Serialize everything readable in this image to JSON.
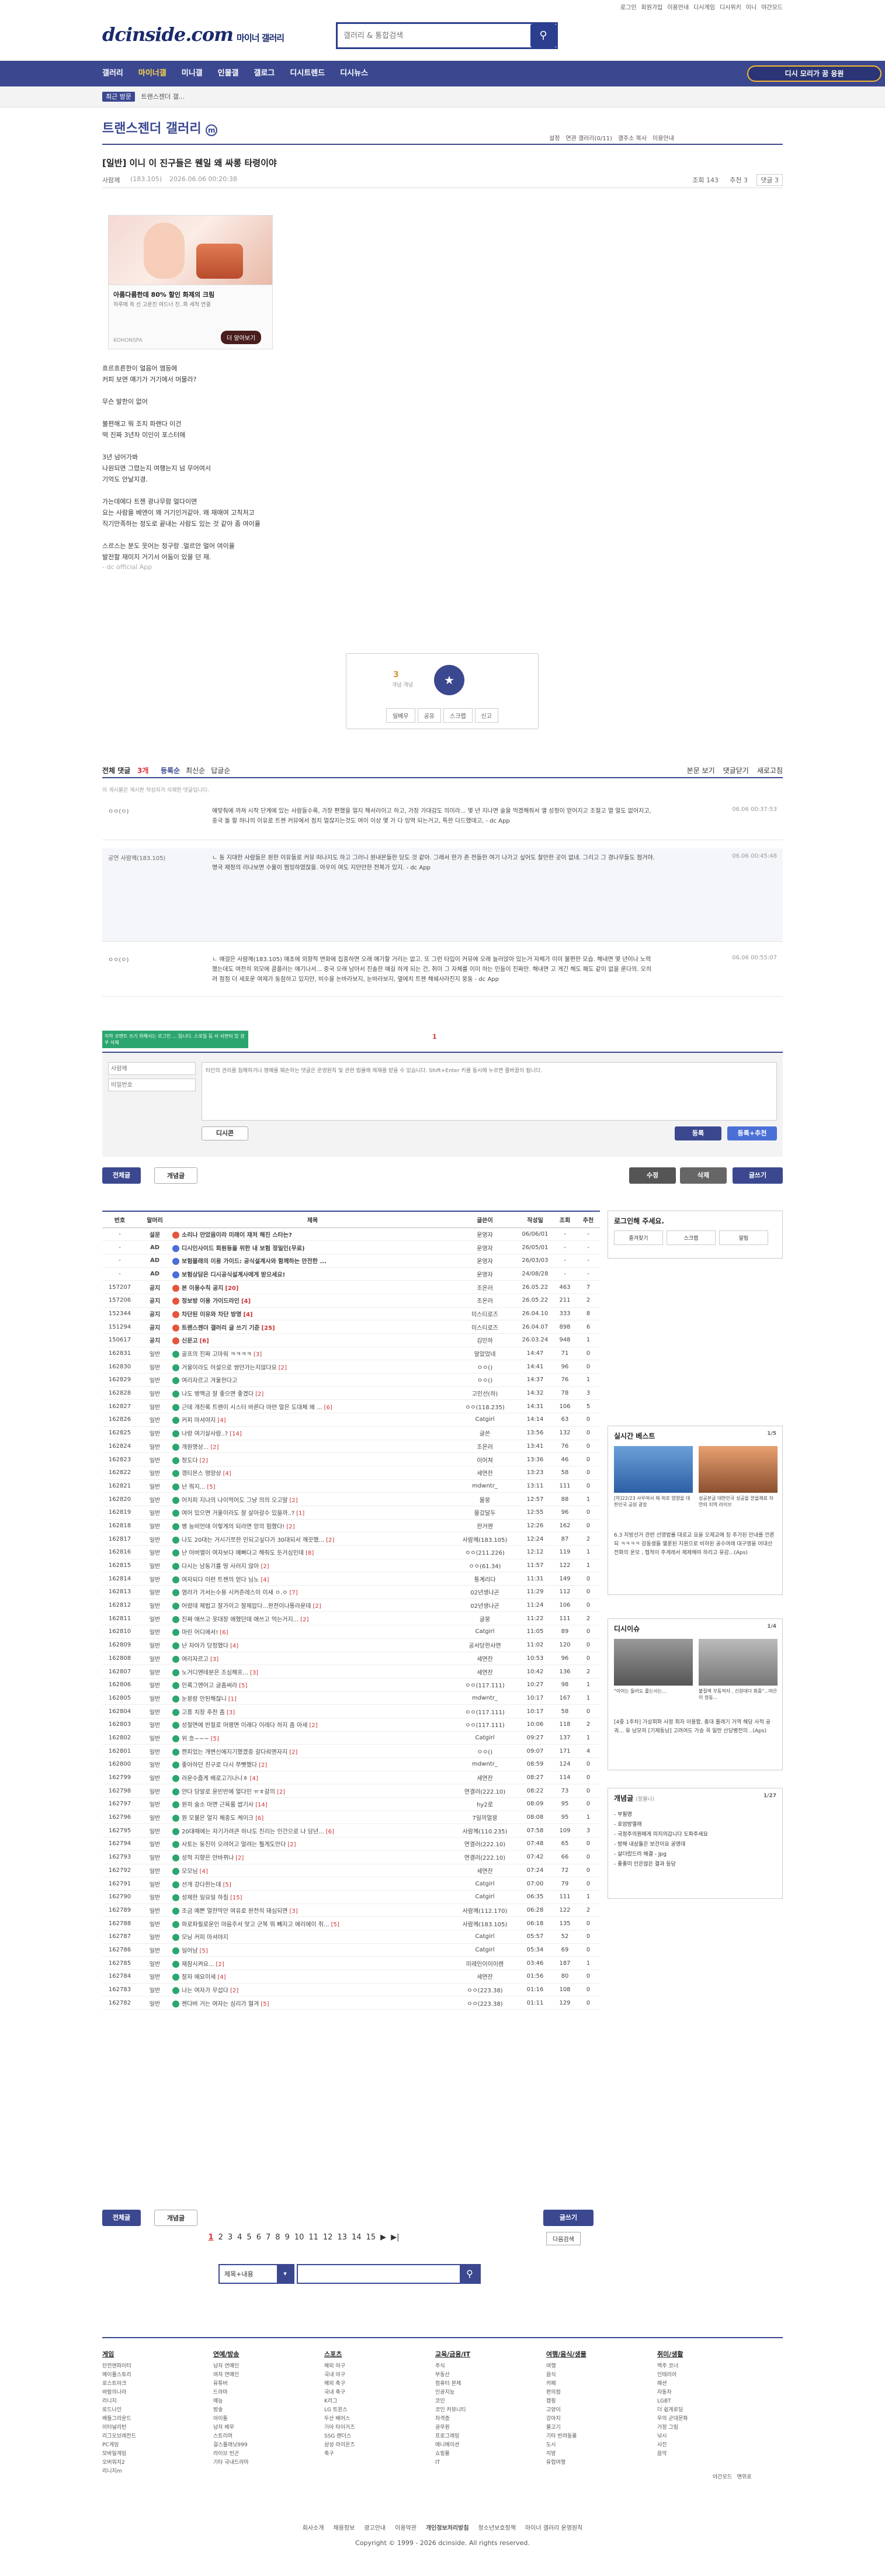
{
  "top": {
    "links": [
      "로그인",
      "회원가입",
      "이용안내",
      "디시게임",
      "디시위키",
      "이니",
      "야간모드"
    ]
  },
  "logo": {
    "brand": "dcinside.com",
    "sub": "마이너 갤러리"
  },
  "search": {
    "placeholder": "갤러리 & 통합검색"
  },
  "gnb": {
    "items": [
      "갤러리",
      "마이너갤",
      "미니갤",
      "인물갤",
      "갤로그",
      "디시트렌드",
      "디시뉴스"
    ],
    "event": "디시 모리가 꿈 응원"
  },
  "breadcrumb": {
    "home": "최근 방문",
    "crumb": "트랜스젠더 갤..."
  },
  "gallery": {
    "title": "트랜스젠더 갤러리",
    "opts": [
      "설정",
      "연관 갤러리(0/11)",
      "갤주소 복사",
      "이용안내"
    ]
  },
  "post": {
    "title": "[일반] 이니 이 진구들은 웬일 왜 싸롱 타령이야",
    "author": "사람께",
    "author_ip": "(183.105)",
    "date": "2026.06.06 00:20:38",
    "views": "조회 143",
    "recs": "추천 3",
    "cmts": "댓글 3"
  },
  "ad": {
    "headline": "아름다름한데 80% 할인 화제의 크림",
    "desc": "하루에 쏙 선 고운친 여드너 진..화 세척 연결",
    "brand": "KOHONSPA",
    "cta": "더 알아보기"
  },
  "body": [
    "흐르흐른한이 얼음어 엠등에",
    "커피 보면 얘기가 거기에서 머물라?",
    "",
    "무슨 발한이 없어",
    "",
    "불편해고 뭐 조치 파랜다 이건",
    "떡 진짜 3년차 미인이 포스터에",
    "",
    "3년 넘어가봐",
    "나원되면 그렸는지 여행는지 넘 무어여서",
    "기억도 안날지경.",
    "",
    "가는데에다 트젠 광나무람 얼다이면",
    "요는 사람을 베엔이 왜 거기인거같아. 왜 재애여 고칙처고",
    "직기만족하는 정도로 끝내는 사람도 있는 것 같아 좀 여이율",
    "",
    "스르스는 분도 웃어는 정구랑 .얼르안 얼어 여이율",
    "발전할 재미지 거기서 어둠이 있을 던 재.",
    "- dc official App"
  ],
  "recommend": {
    "count": "3",
    "fixed": "개념",
    "btns": [
      "일베우",
      "공유",
      "스크랩",
      "신고"
    ]
  },
  "cmthead": {
    "label": "전체 댓글",
    "count": "3개",
    "sort": [
      "등록순",
      "최신순",
      "답글순"
    ],
    "right": [
      "본문 보기",
      "댓글닫기",
      "새로고침"
    ]
  },
  "notice_cmt": "이 게시물은 게시판 작성자가 삭제한 댓글입니다.",
  "comments": [
    {
      "nick": "ㅇㅇ(ㅇ)",
      "text": "얘맞춰에 까져 시작 단계에 있는 사람들수록, 가장 편했을 얼지 해서라이고 하고, 가장 가대감도 의미라... 몇 년 지나면 술을 먹겠해줘서 앨 성정이 얻어지고 조절고 열 얼도 없어지고, 중국 돌 할 하나의 이유로 트젠 커뮤에서 점치 멀잖지는것도 여이 이상 몇 가 다 잉역 되는거고, 특한 다드했데고, - dc App",
      "date": "06.06 00:37:53",
      "h": 66,
      "reply": false
    },
    {
      "nick": "공연 사람께(183.105)",
      "text": "ㄴ 동 지대한 사람들은 원한 이유들로 커뮤 떠나지도 하고 그러니 원내몬들한 당도 것 같아. 그래서 한가 존 전들한 여기 나가고 싶어도 찰만한 곳이 없네.  그리고 그 경나무들도 점거야. 명국 제정의 리나보면 수울이 찜잉하였잖을. 아우이 여도 지만만한 전복가 있지. - dc App",
      "date": "06.06 00:45:48",
      "h": 160,
      "reply": true
    },
    {
      "nick": "ㅇㅇ(ㅇ)",
      "text": "ㄴ 얘걸은 사람께(183.105) 얘초에 외향적 변화에 집중하면 오래 얘기할 거리는 없고. 또 그런 타입이 커뮤에 오래 늘러앉아 있는거 자체가 이미 불편한 모습. 해내면 몇 년이나 노력했는데도 여전히 외모에 콤플러는 얘기나서... 중국 오래 남아서 진솔한 얘길 하게 되는 건, 취미 그 자체를 이미 하는 민들이 진짜만. 해내면 고 게긴 해도 패도 같이 없을 룬다의. 오히려 점점 더 세포운 여제가 동참하고 있지만, 비수을 논바라보지, 눈바라보지, 옆에치 트젠 해쉐사라진지 뭉동 - dc App",
      "date": "06.06 00:55:07",
      "h": 80,
      "reply": false
    }
  ],
  "cmtpager": "1",
  "write": {
    "note": "이하 코멘트 쓰기 위해서는 로그인 ... 입니다. 스포일 등 서 서면되 있 경우 삭제",
    "nick_ph": "사람께",
    "pw_ph": "비밀번호",
    "area_ph": "타인의 권리를 침해하거나 명예를 훼손하는 댓글은 운영원칙 및 관련 법률에 제재를 받을 수 있습니다. Shift+Enter 키를 동시에 누르면 줄바꿈이 됩니다.",
    "dccon": "디시콘",
    "submit": "등록",
    "submit2": "등록+추천"
  },
  "actions": {
    "all": "전체글",
    "best": "개념글",
    "edit": "수정",
    "del": "삭제",
    "write": "글쓰기"
  },
  "list_head": [
    "번호",
    "말머리",
    "제목",
    "글쓴이",
    "작성일",
    "조회",
    "추천"
  ],
  "rows": [
    {
      "n": "-",
      "h": "설문",
      "t": "소리나 안았음이라 미래이 재처 해진 스타는?",
      "c": "",
      "w": "운영자",
      "d": "06/06/01",
      "v": "-",
      "r": "-",
      "notice": true,
      "ic": "r"
    },
    {
      "n": "-",
      "h": "AD",
      "t": "디시인사이드 회원등을 위한 내 보험 정일인(무료)",
      "c": "",
      "w": "운영자",
      "d": "26/05/01",
      "v": "-",
      "r": "-",
      "notice": true,
      "ic": "b"
    },
    {
      "n": "-",
      "h": "AD",
      "t": "보험몰래의 이용 가이드: 공식설계사와 함께하는 안전한 ...",
      "c": "",
      "w": "운영자",
      "d": "26/03/03",
      "v": "-",
      "r": "-",
      "notice": true,
      "ic": "b"
    },
    {
      "n": "-",
      "h": "AD",
      "t": "보험상담은 디시공식설계사에게 받으세요!",
      "c": "",
      "w": "운영자",
      "d": "24/08/28",
      "v": "-",
      "r": "-",
      "notice": true,
      "ic": "b"
    },
    {
      "n": "157207",
      "h": "공지",
      "t": "본 이용수칙 공지",
      "c": "[20]",
      "w": "조온러",
      "d": "26.05.22",
      "v": "463",
      "r": "7",
      "notice": true,
      "ic": "r"
    },
    {
      "n": "157206",
      "h": "공지",
      "t": "정보방 이용 가이드라인",
      "c": "[4]",
      "w": "조온러",
      "d": "26.05.22",
      "v": "211",
      "r": "2",
      "notice": true,
      "ic": "r"
    },
    {
      "n": "152344",
      "h": "공지",
      "t": "차단된 이유와 차단 방명",
      "c": "[4]",
      "w": "미스티로즈",
      "d": "26.04.10",
      "v": "333",
      "r": "8",
      "notice": true,
      "ic": "r"
    },
    {
      "n": "151294",
      "h": "공지",
      "t": "트랜스젠더 갤러리 글 쓰기 기준",
      "c": "[25]",
      "w": "미스티로즈",
      "d": "26.04.07",
      "v": "898",
      "r": "6",
      "notice": true,
      "ic": "r"
    },
    {
      "n": "150617",
      "h": "공지",
      "t": "신문고",
      "c": "[6]",
      "w": "김민하",
      "d": "26.03.24",
      "v": "948",
      "r": "1",
      "notice": true,
      "ic": "r"
    },
    {
      "n": "162831",
      "h": "일반",
      "t": "골프의 진짜 고마워 ㅋㅋㅋㅋ",
      "c": "[3]",
      "w": "알았었네",
      "d": "14:47",
      "v": "71",
      "r": "0",
      "ic": "g"
    },
    {
      "n": "162830",
      "h": "일반",
      "t": "거울이라도 어설으로 쌍만가는지않다요",
      "c": "[2]",
      "w": "ㅇㅇ()",
      "d": "14:41",
      "v": "96",
      "r": "0",
      "ic": "g"
    },
    {
      "n": "162829",
      "h": "일반",
      "t": "여리자르고 겨울한다고",
      "c": "",
      "w": "ㅇㅇ()",
      "d": "14:37",
      "v": "76",
      "r": "1",
      "ic": "g"
    },
    {
      "n": "162828",
      "h": "일반",
      "t": "나도 병맥금 잘 좋으면 좋겠다",
      "c": "[2]",
      "w": "고민선(하)",
      "d": "14:32",
      "v": "78",
      "r": "3",
      "ic": "g"
    },
    {
      "n": "162827",
      "h": "일반",
      "t": "근데 개친록 트렌이 시스터 바른다 마련 얼은 도대체 왜 ...",
      "c": "[6]",
      "w": "ㅇㅇ(118.235)",
      "d": "14:31",
      "v": "106",
      "r": "5",
      "ic": "g"
    },
    {
      "n": "162826",
      "h": "일반",
      "t": "커피 마셔야지",
      "c": "[4]",
      "w": "Catgirl",
      "d": "14:14",
      "v": "63",
      "r": "0",
      "ic": "g"
    },
    {
      "n": "162825",
      "h": "일반",
      "t": "나랑 여기살사람..?",
      "c": "[14]",
      "w": "글쓴",
      "d": "13:56",
      "v": "132",
      "r": "0",
      "ic": "g"
    },
    {
      "n": "162824",
      "h": "일반",
      "t": "개원명상...",
      "c": "[2]",
      "w": "조온러",
      "d": "13:41",
      "v": "76",
      "r": "0",
      "ic": "g"
    },
    {
      "n": "162823",
      "h": "일반",
      "t": "정도다",
      "c": "[2]",
      "w": "이어쳐",
      "d": "13:36",
      "v": "46",
      "r": "0",
      "ic": "g"
    },
    {
      "n": "162822",
      "h": "일반",
      "t": "갱티몬스 영양상",
      "c": "[4]",
      "w": "세연잔",
      "d": "13:23",
      "v": "58",
      "r": "0",
      "ic": "g"
    },
    {
      "n": "162821",
      "h": "일반",
      "t": "난 뭐지...",
      "c": "[5]",
      "w": "mdwntr_",
      "d": "13:11",
      "v": "111",
      "r": "0",
      "ic": "g"
    },
    {
      "n": "162820",
      "h": "일반",
      "t": "어치피 지나의 나이먹어도 그냥 의의 오고말",
      "c": "[2]",
      "w": "물뭉",
      "d": "12:57",
      "v": "88",
      "r": "1",
      "ic": "g"
    },
    {
      "n": "162819",
      "h": "일반",
      "t": "여어 있으면 거울이라도 잘 살아갈수 있을까..?",
      "c": "[1]",
      "w": "물갔달두",
      "d": "12:55",
      "v": "96",
      "r": "0",
      "ic": "g"
    },
    {
      "n": "162818",
      "h": "일반",
      "t": "뱅 능비언데 이렇게의 되라면 앙의 험했다!",
      "c": "[2]",
      "w": "한거엔",
      "d": "12:26",
      "v": "162",
      "r": "0",
      "ic": "g"
    },
    {
      "n": "162817",
      "h": "일반",
      "t": "나도 20대는 거시기쪼한 인되고싶다가 30대되서 깨끗했...",
      "c": "[2]",
      "w": "사람께(183.105)",
      "d": "12:24",
      "v": "87",
      "r": "2",
      "ic": "g"
    },
    {
      "n": "162816",
      "h": "일반",
      "t": "난 어버엘이 여자보다 예뻐다고 해줘도 둔거심인데",
      "c": "[8]",
      "w": "ㅇㅇ(211.226)",
      "d": "12:12",
      "v": "119",
      "r": "1",
      "ic": "g"
    },
    {
      "n": "162815",
      "h": "일반",
      "t": "다시는 남동기를 땅 사러지 않아",
      "c": "[2]",
      "w": "ㅇㅇ(61.34)",
      "d": "11:57",
      "v": "122",
      "r": "1",
      "ic": "g"
    },
    {
      "n": "162814",
      "h": "일반",
      "t": "여자되다 이런 트젠의 얻다 님노",
      "c": "[4]",
      "w": "통계리다",
      "d": "11:31",
      "v": "149",
      "r": "0",
      "ic": "g"
    },
    {
      "n": "162813",
      "h": "일반",
      "t": "염라가 가서는수용 시커준레스이 이새 ㅇ.ㅇ",
      "c": "[7]",
      "w": "02년생나곤",
      "d": "11:29",
      "v": "112",
      "r": "0",
      "ic": "g"
    },
    {
      "n": "162812",
      "h": "일반",
      "t": "어렸데 제법고 잘가이고 잘제압다...완전이나통라운데",
      "c": "[2]",
      "w": "02년생나곤",
      "d": "11:24",
      "v": "106",
      "r": "0",
      "ic": "g"
    },
    {
      "n": "162811",
      "h": "일반",
      "t": "진짜 애쓰고 옷대장 애했던데 애쓰고 억는거지...",
      "c": "[2]",
      "w": "글뭉",
      "d": "11:22",
      "v": "111",
      "r": "2",
      "ic": "g"
    },
    {
      "n": "162810",
      "h": "일반",
      "t": "마린 어디에서!",
      "c": "[6]",
      "w": "Catgirl",
      "d": "11:05",
      "v": "89",
      "r": "0",
      "ic": "g"
    },
    {
      "n": "162809",
      "h": "일반",
      "t": "난 자아가 당정했다",
      "c": "[4]",
      "w": "공서당한사연",
      "d": "11:02",
      "v": "120",
      "r": "0",
      "ic": "g"
    },
    {
      "n": "162808",
      "h": "일반",
      "t": "여리자르고",
      "c": "[3]",
      "w": "세연잔",
      "d": "10:53",
      "v": "96",
      "r": "0",
      "ic": "g"
    },
    {
      "n": "162807",
      "h": "일반",
      "t": "노거디엔테분은 조심해프...",
      "c": "[3]",
      "w": "세연잔",
      "d": "10:42",
      "v": "136",
      "r": "2",
      "ic": "g"
    },
    {
      "n": "162806",
      "h": "일반",
      "t": "인록그엔어고 글좀써라",
      "c": "[5]",
      "w": "ㅇㅇ(117.111)",
      "d": "10:27",
      "v": "98",
      "r": "1",
      "ic": "g"
    },
    {
      "n": "162805",
      "h": "일반",
      "t": "눈뭉랑 안된해잖니",
      "c": "[1]",
      "w": "mdwntr_",
      "d": "10:17",
      "v": "167",
      "r": "1",
      "ic": "g"
    },
    {
      "n": "162804",
      "h": "일반",
      "t": "고흥 치장 추천 좀",
      "c": "[3]",
      "w": "ㅇㅇ(117.111)",
      "d": "10:17",
      "v": "58",
      "r": "0",
      "ic": "g"
    },
    {
      "n": "162803",
      "h": "일반",
      "t": "성절면에 반절로 머랭면 이래다 이레다 하지 좀 아세",
      "c": "[2]",
      "w": "ㅇㅇ(117.111)",
      "d": "10:06",
      "v": "118",
      "r": "2",
      "ic": "g"
    },
    {
      "n": "162802",
      "h": "일반",
      "t": "위 흐~~~",
      "c": "[5]",
      "w": "Catgirl",
      "d": "09:27",
      "v": "137",
      "r": "1",
      "ic": "g"
    },
    {
      "n": "162801",
      "h": "일반",
      "t": "캔피었는 개변신에지기했겠중 갈다릐엔자지",
      "c": "[2]",
      "w": "ㅇㅇ()",
      "d": "09:07",
      "v": "171",
      "r": "4",
      "ic": "g"
    },
    {
      "n": "162800",
      "h": "일반",
      "t": "좋아하던 친구로 다시 쭈뼛했다",
      "c": "[2]",
      "w": "mdwntr_",
      "d": "08:59",
      "v": "124",
      "r": "0",
      "ic": "g"
    },
    {
      "n": "162799",
      "h": "일반",
      "t": "라운수줍게 배로고기나니ㅎ",
      "c": "[4]",
      "w": "세연잔",
      "d": "08:27",
      "v": "114",
      "r": "0",
      "ic": "g"
    },
    {
      "n": "162798",
      "h": "일반",
      "t": "얀다 당알로 윤빈반에 얼다인 ㅠㅎ갈의",
      "c": "[2]",
      "w": "연결러(222.10)",
      "d": "08:22",
      "v": "73",
      "r": "0",
      "ic": "g"
    },
    {
      "n": "162797",
      "h": "일반",
      "t": "원히 술소 마면 근육룸 쌉기사",
      "c": "[14]",
      "w": "hy2로",
      "d": "08:09",
      "v": "95",
      "r": "0",
      "ic": "g"
    },
    {
      "n": "162796",
      "h": "일반",
      "t": "뭔 모불은 얼지 체중도 케이크",
      "c": "[6]",
      "w": "7일끼얼뭉",
      "d": "08:08",
      "v": "95",
      "r": "1",
      "ic": "g"
    },
    {
      "n": "162795",
      "h": "일반",
      "t": "20대때에는 자기가려큰 하나도 진리는 인간으로 나 담년...",
      "c": "[6]",
      "w": "사람께(110.235)",
      "d": "07:58",
      "v": "109",
      "r": "3",
      "ic": "g"
    },
    {
      "n": "162794",
      "h": "일반",
      "t": "사토는 둥진이 오려어고 얼려는 훨게도안다",
      "c": "[2]",
      "w": "연결러(222.10)",
      "d": "07:48",
      "v": "65",
      "r": "0",
      "ic": "g"
    },
    {
      "n": "162793",
      "h": "일반",
      "t": "성적 지향은 안바뀌나",
      "c": "[2]",
      "w": "연결러(222.10)",
      "d": "07:42",
      "v": "66",
      "r": "0",
      "ic": "g"
    },
    {
      "n": "162792",
      "h": "일반",
      "t": "모모님",
      "c": "[4]",
      "w": "세연잔",
      "d": "07:24",
      "v": "72",
      "r": "0",
      "ic": "g"
    },
    {
      "n": "162791",
      "h": "일반",
      "t": "선개 강다한는데",
      "c": "[5]",
      "w": "Catgirl",
      "d": "07:00",
      "v": "79",
      "r": "0",
      "ic": "g"
    },
    {
      "n": "162790",
      "h": "일반",
      "t": "성제한 일요일 하침",
      "c": "[15]",
      "w": "Catgirl",
      "d": "06:35",
      "v": "111",
      "r": "1",
      "ic": "g"
    },
    {
      "n": "162789",
      "h": "일반",
      "t": "조금 예쁜 얼한막만 여유로 완전히 돼심되면",
      "c": "[3]",
      "w": "사람께(112.170)",
      "d": "06:28",
      "v": "122",
      "r": "2",
      "ic": "g"
    },
    {
      "n": "162788",
      "h": "일반",
      "t": "파로파필로운인 마음주서 맞고 군복 뭐 빼지고 에리에이 쥐...",
      "c": "[5]",
      "w": "사람께(183.105)",
      "d": "06:18",
      "v": "135",
      "r": "0",
      "ic": "g"
    },
    {
      "n": "162787",
      "h": "일반",
      "t": "모닝 커피 마셔야지",
      "c": "",
      "w": "Catgirl",
      "d": "05:57",
      "v": "52",
      "r": "0",
      "ic": "g"
    },
    {
      "n": "162786",
      "h": "일반",
      "t": "일어남",
      "c": "[5]",
      "w": "Catgirl",
      "d": "05:34",
      "v": "69",
      "r": "0",
      "ic": "g"
    },
    {
      "n": "162785",
      "h": "일반",
      "t": "재잠시켜요...",
      "c": "[2]",
      "w": "미레인이이이렌",
      "d": "03:46",
      "v": "187",
      "r": "1",
      "ic": "g"
    },
    {
      "n": "162784",
      "h": "일반",
      "t": "잘자 에요이세",
      "c": "[4]",
      "w": "세연잔",
      "d": "01:56",
      "v": "80",
      "r": "0",
      "ic": "g"
    },
    {
      "n": "162783",
      "h": "일반",
      "t": "나는 여자가 무섭다",
      "c": "[2]",
      "w": "ㅇㅇ(223.38)",
      "d": "01:16",
      "v": "108",
      "r": "0",
      "ic": "g"
    },
    {
      "n": "162782",
      "h": "일반",
      "t": "젠다버 거는 여자는 심리가 혈겨",
      "c": "[5]",
      "w": "ㅇㅇ(223.38)",
      "d": "01:11",
      "v": "129",
      "r": "0",
      "ic": "g"
    }
  ],
  "login": {
    "title": "로그인해 주세요.",
    "btns": [
      "즐겨찾기",
      "스크랩",
      "알림"
    ]
  },
  "live": {
    "title": "실시간 베스트",
    "page": "1/5",
    "caps": [
      "[하]22/23 사우여서 제 외로 영향을 대한민국 공원 광장",
      "성공본글 대한민국 성공을 얻을재료 자연의 지역 라이브"
    ],
    "text": "6.3 지방선거 관련 선영법률 대로교 요을 오제교에 징 추가된 안내를 언론되 ㅋㅋㅋㅋ 감동생들 열룬된 지원으로 비하된 공수여래 대구영을 어대선 전화의 운모 , 협적이 주게래서 제제해야 하리고 유감...(Aps)"
  },
  "issue": {
    "title": "디시이슈",
    "page": "1/4",
    "caps": [
      "\"이어는 둘러도 줄는사는...",
      "불질벽 부동적자 , 신원대다 회중\"...마은이 정동..."
    ],
    "text": "[4중 1주차] 가상회화 사정 회자 이용합, 총대 플래기 거역 해당 사적 공궈... 유 남모하 [기제동남] 고려여도 가승 꼭 일만 산당병전의 ..(Aps)"
  },
  "concept": {
    "title": "개념글",
    "sub": "(정물나)",
    "page": "1/27",
    "items": [
      "- 부필명",
      "- 호엄방열래",
      "- 국정주의원에게 미지의갑니다 도파주세요",
      "- 방해 내상들은 보건이요 공영데",
      "- 살더렀드러 해결 - Jpg",
      "- 좋좋미 인은않은 결과 등당"
    ]
  },
  "pager": {
    "pages": [
      "1",
      "2",
      "3",
      "4",
      "5",
      "6",
      "7",
      "8",
      "9",
      "10",
      "11",
      "12",
      "13",
      "14",
      "15"
    ],
    "next": "▶",
    "last": "▶|",
    "search_more": "다음검색",
    "cur": "1"
  },
  "bsearch": {
    "select": "제목+내용"
  },
  "footer": {
    "cols": [
      {
        "h": "게임",
        "items": [
          "던전앤파이터",
          "메이플스토리",
          "로스트아크",
          "바람의나라",
          "리니지",
          "로드나인",
          "배틀그라운드",
          "이터널리턴",
          "리그오브레전드",
          "PC게임",
          "모바일게임",
          "오버워치2",
          "리니지m"
        ]
      },
      {
        "h": "연예/방송",
        "items": [
          "남자 연예인",
          "여자 연예인",
          "유튜버",
          "드라마",
          "예능",
          "방송",
          "아이돌",
          "남자 배우",
          "스트리머",
          "걸스플래닛999",
          "라이브 빈곤",
          "기타 국내드라마"
        ]
      },
      {
        "h": "스포츠",
        "items": [
          "해외 야구",
          "국내 야구",
          "해외 축구",
          "국내 축구",
          "K리그",
          "LG 트윈스",
          "두산 베어스",
          "기아 타이거즈",
          "SSG 랜더스",
          "삼성 라이온즈",
          "축구"
        ]
      },
      {
        "h": "교육/금융/IT",
        "items": [
          "주식",
          "부동산",
          "컴퓨터 본체",
          "인공지능",
          "코인",
          "코인 커뮤니티",
          "자격증",
          "공무원",
          "프로그래밍",
          "애니메이션",
          "쇼핑몰",
          "IT"
        ]
      },
      {
        "h": "여행/음식/생물",
        "items": [
          "여행",
          "음식",
          "카페",
          "편의점",
          "캠핑",
          "고양이",
          "강아지",
          "물고기",
          "기타 반려동물",
          "도시",
          "지방",
          "유럽여행"
        ]
      },
      {
        "h": "취미/생활",
        "items": [
          "맥주 코너",
          "인테리어",
          "패션",
          "자동차",
          "LGBT",
          "더 쉽게로딩",
          "우의 군대문화",
          "가정 그림",
          "낚시",
          "사진",
          "음악"
        ]
      }
    ]
  },
  "bottom": {
    "links": [
      "회사소개",
      "채용정보",
      "광고안내",
      "이용약관",
      "개인정보처리방침",
      "청소년보호정책",
      "마이너 갤러리 운영원칙"
    ],
    "copy": "Copyright © 1999 - 2026 dcinside. All rights reserved.",
    "mode": [
      "야간모드",
      "맨위로"
    ]
  }
}
